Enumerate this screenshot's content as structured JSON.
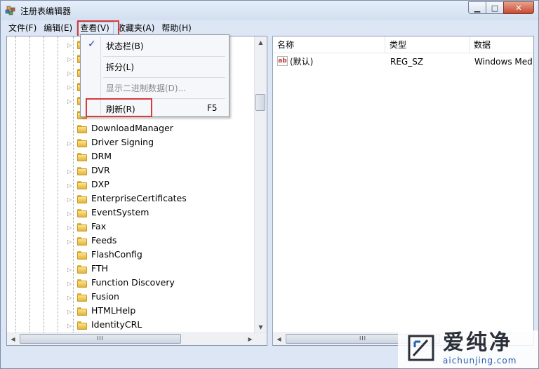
{
  "window": {
    "title": "注册表编辑器",
    "controls": {
      "minimize": "▁",
      "maximize": "□",
      "close": "✕"
    }
  },
  "menubar": {
    "items": [
      {
        "label": "文件(F)"
      },
      {
        "label": "编辑(E)"
      },
      {
        "label": "查看(V)",
        "active": true
      },
      {
        "label": "收藏夹(A)"
      },
      {
        "label": "帮助(H)"
      }
    ]
  },
  "view_menu": {
    "items": [
      {
        "label": "状态栏(B)",
        "checked": true,
        "check_glyph": "✓"
      },
      {
        "label": "拆分(L)"
      },
      {
        "label": "显示二进制数据(D)...",
        "disabled": true
      },
      {
        "label": "刷新(R)",
        "shortcut": "F5",
        "highlighted": true
      }
    ]
  },
  "tree": {
    "items": [
      "DownloadManager",
      "Driver Signing",
      "DRM",
      "DVR",
      "DXP",
      "EnterpriseCertificates",
      "EventSystem",
      "Fax",
      "Feeds",
      "FlashConfig",
      "FTH",
      "Function Discovery",
      "Fusion",
      "HTMLHelp",
      "IdentityCRL"
    ]
  },
  "values_pane": {
    "columns": [
      "名称",
      "类型",
      "数据"
    ],
    "rows": [
      {
        "name": "(默认)",
        "type": "REG_SZ",
        "data": "Windows Med",
        "icon": "ab-string-icon",
        "icon_text": "ab"
      }
    ]
  },
  "scrollbars": {
    "grip": "≡",
    "hgrip": "III",
    "left": "◀",
    "right": "▶",
    "up": "▲",
    "down": "▼"
  },
  "watermark": {
    "title": "爱纯净",
    "url": "aichunjing.com"
  },
  "colors": {
    "highlight_box": "#d93a3a",
    "menu_active": "#e4ecf7",
    "folder": "#e3b43a"
  }
}
